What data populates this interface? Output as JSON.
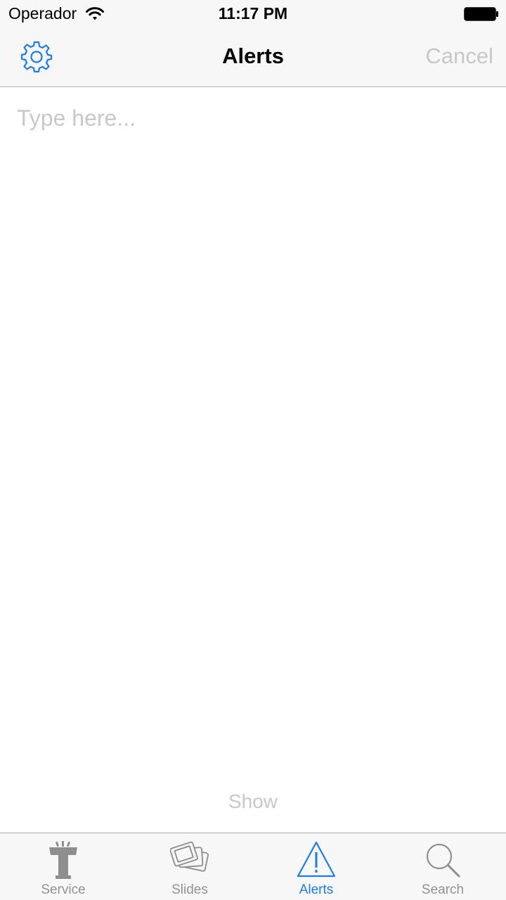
{
  "status_bar": {
    "carrier": "Operador",
    "time": "11:17 PM"
  },
  "nav_bar": {
    "title": "Alerts",
    "cancel_label": "Cancel",
    "settings_icon": "gear-icon"
  },
  "alert_input": {
    "placeholder": "Type here...",
    "value": ""
  },
  "show_label": "Show",
  "tab_bar": {
    "tabs": [
      {
        "label": "Service",
        "icon": "podium-icon",
        "active": false
      },
      {
        "label": "Slides",
        "icon": "slides-icon",
        "active": false
      },
      {
        "label": "Alerts",
        "icon": "warning-icon",
        "active": true
      },
      {
        "label": "Search",
        "icon": "search-icon",
        "active": false
      }
    ]
  },
  "colors": {
    "accent": "#1a7cf0",
    "inactive": "#929292",
    "disabled_text": "#c7c7cc",
    "bar_background": "#f7f7f7"
  }
}
